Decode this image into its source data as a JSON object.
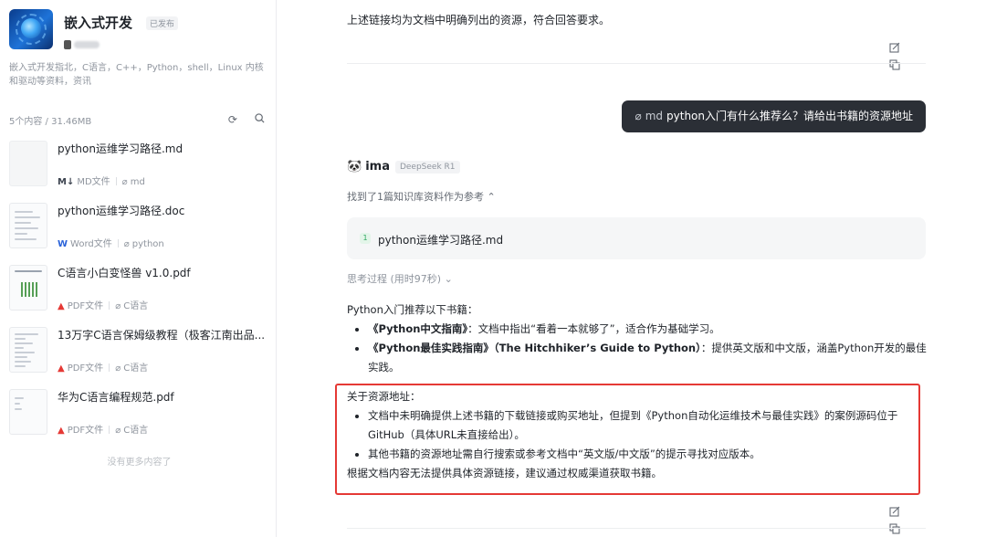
{
  "sidebar": {
    "kb_title": "嵌入式开发",
    "kb_badge": "已发布",
    "kb_desc": "嵌入式开发指北，C语言，C++，Python，shell，Linux 内核和驱动等资料，资讯",
    "stats": "5个内容 / 31.46MB",
    "files": [
      {
        "name": "python运维学习路径.md",
        "type_icon": "M↓",
        "type_label": "MD文件",
        "type_color": "#3d4450",
        "tag": "md"
      },
      {
        "name": "python运维学习路径.doc",
        "type_icon": "W",
        "type_label": "Word文件",
        "type_color": "#2b63d9",
        "tag": "python"
      },
      {
        "name": "C语言小白变怪兽 v1.0.pdf",
        "type_icon": "▲",
        "type_label": "PDF文件",
        "type_color": "#e53935",
        "tag": "C语言"
      },
      {
        "name": "13万字C语言保姆级教程（极客江南出品...",
        "type_icon": "▲",
        "type_label": "PDF文件",
        "type_color": "#e53935",
        "tag": "C语言"
      },
      {
        "name": "华为C语言编程规范.pdf",
        "type_icon": "▲",
        "type_label": "PDF文件",
        "type_color": "#e53935",
        "tag": "C语言"
      }
    ],
    "no_more": "没有更多内容了"
  },
  "chat": {
    "prev_msg_tail": "上述链接均为文档中明确列出的资源，符合回答要求。",
    "user_prefix": "md",
    "user_question": "python入门有什么推荐么？请给出书籍的资源地址",
    "ai_name": "ima",
    "ai_model": "DeepSeek R1",
    "refs_line": "找到了1篇知识库资料作为参考",
    "ref_num": "1",
    "ref_title": "python运维学习路径.md",
    "think_line": "思考过程 (用时97秒)",
    "answer_intro": "Python入门推荐以下书籍：",
    "book1_title": "《Python中文指南》",
    "book1_desc": "：文档中指出“看着一本就够了”，适合作为基础学习。",
    "book2_title": "《Python最佳实践指南》（The Hitchhiker’s Guide to Python）",
    "book2_desc": "：提供英文版和中文版，涵盖Python开发的最佳实践。",
    "res_heading": "关于资源地址：",
    "res_item1": "文档中未明确提供上述书籍的下载链接或购买地址，但提到《Python自动化运维技术与最佳实践》的案例源码位于GitHub（具体URL未直接给出）。",
    "res_item2": "其他书籍的资源地址需自行搜索或参考文档中“英文版/中文版”的提示寻找对应版本。",
    "conclusion": "根据文档内容无法提供具体资源链接，建议通过权威渠道获取书籍。"
  },
  "icons": {
    "edit": "edit-icon",
    "copy": "copy-icon",
    "tag": "tag-icon",
    "search": "search-icon",
    "new": "new-icon"
  },
  "colors": {
    "highlight_border": "#e53935",
    "user_bubble_bg": "#2b2f36"
  }
}
